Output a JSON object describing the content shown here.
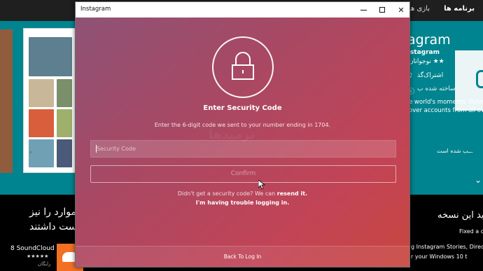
{
  "store": {
    "nav": {
      "active": "برنامه ها",
      "games": "بازی ها",
      "more": "..."
    },
    "app": {
      "title": "agram",
      "publisher": "Instagram",
      "category": "نوجوانان ★★",
      "share_label": "اشتراک‌گذ",
      "made_label": "ساخته شده ب",
      "desc_line1": "e world's moments. Follow",
      "desc_line2": "over accounts from all ove",
      "note": "ــب شده است."
    },
    "left_text_1": "ـد این موارد را نیز",
    "left_text_2": "ست داشتند",
    "soundcloud": {
      "name": "8 SoundCloud",
      "stars": "★★★★★",
      "price": "رایگان"
    },
    "right_heading": "ید این نسخه",
    "right_fixed": "Fixed a cra",
    "right_line1": "g Instagram Stories, Direct and",
    "right_line2": "r your Windows 10 t",
    "accent": "#00848f"
  },
  "window": {
    "title": "Instagram",
    "heading": "Enter Security Code",
    "subtext": "Enter the 6-digit code we sent to your number ending in 1704.",
    "watermark": "ترمیدها",
    "input_placeholder": "Security Code",
    "input_value": "",
    "confirm_label": "Confirm",
    "resend_prefix": "Didn't get a security code? We can",
    "resend_link": "resend it.",
    "trouble_link": "I'm having trouble logging in.",
    "back_link": "Back To Log In",
    "gradient_start": "#8c5377",
    "gradient_end": "#c8463f"
  }
}
